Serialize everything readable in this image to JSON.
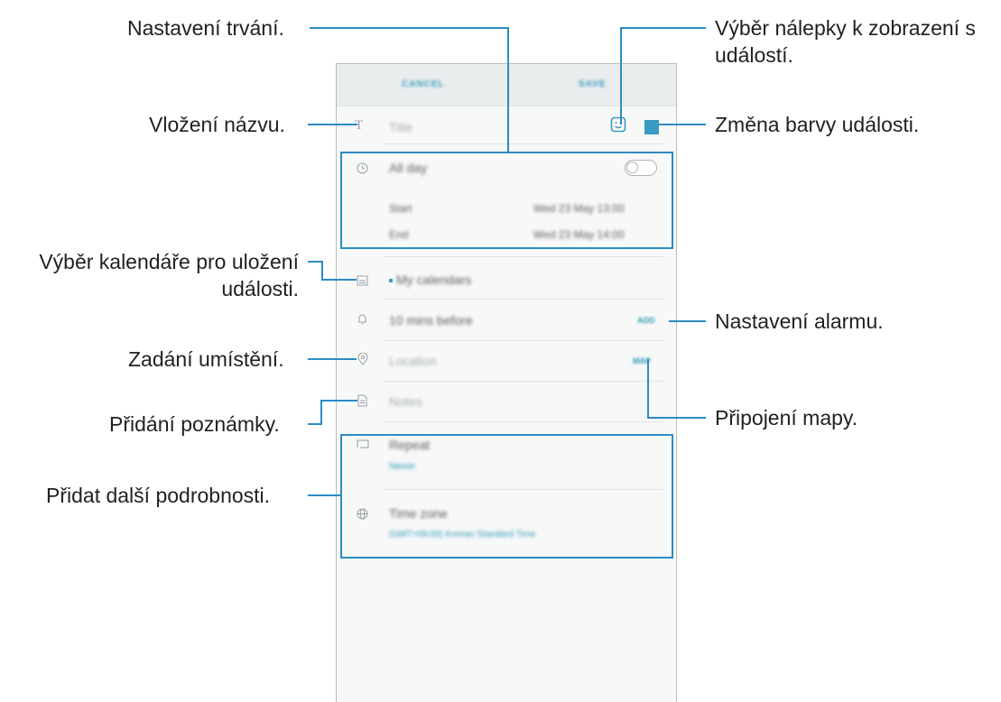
{
  "phone": {
    "topbar": {
      "cancel": "CANCEL",
      "save": "SAVE"
    },
    "title_placeholder": "Title",
    "all_day": "All day",
    "start_label": "Start",
    "start_value": "Wed 23 May  13:00",
    "end_label": "End",
    "end_value": "Wed 23 May  14:00",
    "calendar": "My calendars",
    "alarm": "10 mins before",
    "alarm_action": "ADD",
    "location_placeholder": "Location",
    "map_action": "MAP",
    "notes_placeholder": "Notes",
    "repeat_label": "Repeat",
    "repeat_value": "Never",
    "timezone_label": "Time zone",
    "timezone_value": "(GMT+09:00) Korean Standard Time"
  },
  "callouts": {
    "duration": "Nastavení trvání.",
    "sticker_line1": "Výběr nálepky k zobrazení s",
    "sticker_line2": "událostí.",
    "title": "Vložení názvu.",
    "color": "Změna barvy události.",
    "calendar_line1": "Výběr kalendáře pro uložení",
    "calendar_line2": "události.",
    "alarm": "Nastavení alarmu.",
    "location": "Zadání umístění.",
    "map": "Připojení mapy.",
    "note": "Přidání poznámky.",
    "more": "Přidat další podrobnosti."
  },
  "colors": {
    "accent": "#2b8cc4",
    "event_color": "#3b9bc2"
  }
}
